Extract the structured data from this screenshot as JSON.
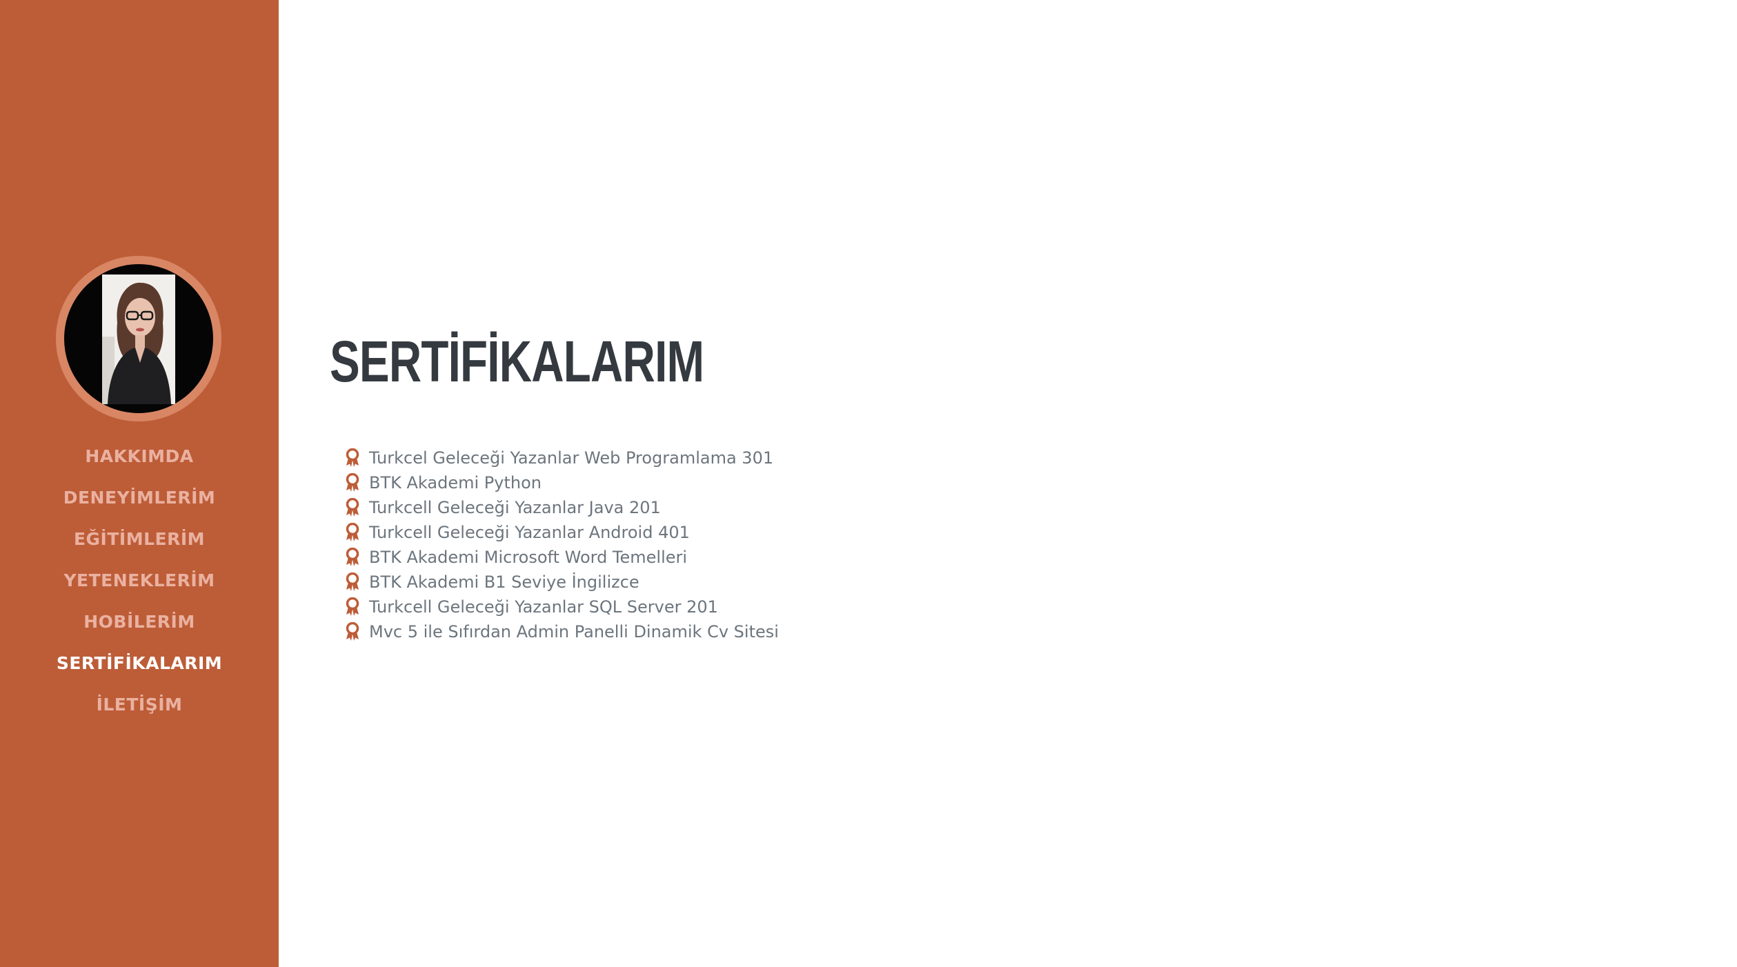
{
  "sidebar": {
    "bg_color": "#bd5d38",
    "avatar": {
      "alt": "profile-photo"
    },
    "nav_items": [
      {
        "label": "HAKKIMDA",
        "active": false
      },
      {
        "label": "DENEYİMLERİM",
        "active": false
      },
      {
        "label": "EĞİTİMLERİM",
        "active": false
      },
      {
        "label": "YETENEKLERİM",
        "active": false
      },
      {
        "label": "HOBİLERİM",
        "active": false
      },
      {
        "label": "SERTİFİKALARIM",
        "active": true
      },
      {
        "label": "İLETİŞİM",
        "active": false
      }
    ]
  },
  "main": {
    "title": "SERTİFİKALARIM",
    "list_icon": "award-icon",
    "certificates": [
      "Turkcel Geleceği Yazanlar Web Programlama 301",
      "BTK Akademi Python",
      "Turkcell Geleceği Yazanlar Java 201",
      "Turkcell Geleceği Yazanlar Android 401",
      "BTK Akademi Microsoft Word Temelleri",
      "BTK Akademi B1 Seviye İngilizce",
      "Turkcell Geleceği Yazanlar SQL Server 201",
      "Mvc 5 ile Sıfırdan Admin Panelli Dinamik Cv Sitesi"
    ]
  },
  "colors": {
    "accent": "#bd5d38",
    "nav_text": "#eab1a0",
    "nav_active": "#ffffff",
    "heading": "#343a40",
    "body_text": "#6c757d"
  }
}
